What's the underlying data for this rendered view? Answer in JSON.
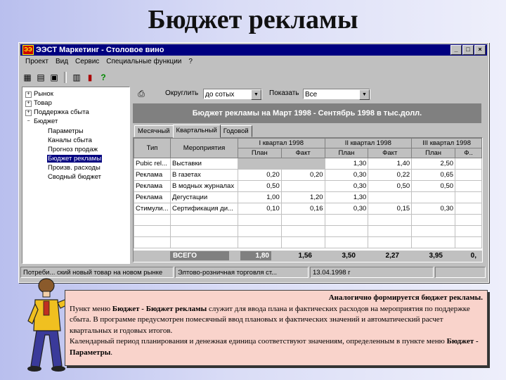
{
  "slide": {
    "title": "Бюджет рекламы"
  },
  "window": {
    "title": "ЭЭСТ Маркетинг - Столовое вино",
    "app_icon": "ЭЭ",
    "controls": {
      "minimize": "_",
      "maximize": "□",
      "close": "×"
    }
  },
  "menu": [
    "Проект",
    "Вид",
    "Сервис",
    "Специальные функции",
    "?"
  ],
  "toolbar_icons": [
    "grid-icon",
    "table-icon",
    "form-icon",
    "calculator-icon",
    "exit-door-icon",
    "help-icon"
  ],
  "tree": [
    {
      "label": "Рынок",
      "expander": "+",
      "level": 0
    },
    {
      "label": "Товар",
      "expander": "+",
      "level": 0
    },
    {
      "label": "Поддержка сбыта",
      "expander": "+",
      "level": 0
    },
    {
      "label": "Бюджет",
      "expander": "−",
      "level": 0
    },
    {
      "label": "Параметры",
      "level": 1
    },
    {
      "label": "Каналы сбыта",
      "level": 1
    },
    {
      "label": "Прогноз продаж",
      "level": 1
    },
    {
      "label": "Бюджет рекламы",
      "level": 1,
      "selected": true
    },
    {
      "label": "Произв. расходы",
      "level": 1
    },
    {
      "label": "Сводный бюджет",
      "level": 1
    }
  ],
  "options": {
    "round_label": "Округлить",
    "round_value": "до сотых",
    "show_label": "Показать",
    "show_value": "Все"
  },
  "banner": "Бюджет рекламы на Март 1998 - Сентябрь 1998 в тыс.долл.",
  "tabs": [
    "Месячный",
    "Квартальный",
    "Годовой"
  ],
  "grid": {
    "col_type": "Тип",
    "col_event": "Мероприятия",
    "quarters": [
      "I квартал 1998",
      "II квартал 1998",
      "III квартал 1998"
    ],
    "plan": "План",
    "fact": "Факт",
    "fact_cut": "Ф..",
    "rows": [
      {
        "type": "Pubic rel...",
        "event": "Выставки",
        "v": [
          "",
          "",
          "1,30",
          "1,40",
          "2,50",
          ""
        ]
      },
      {
        "type": "Реклама",
        "event": "В газетах",
        "v": [
          "0,20",
          "0,20",
          "0,30",
          "0,22",
          "0,65",
          ""
        ]
      },
      {
        "type": "Реклама",
        "event": "В модных журналах",
        "v": [
          "0,50",
          "",
          "0,30",
          "0,50",
          "0,50",
          ""
        ]
      },
      {
        "type": "Реклама",
        "event": "Дегустации",
        "v": [
          "1,00",
          "1,20",
          "1,30",
          "",
          "",
          ""
        ]
      },
      {
        "type": "Стимули...",
        "event": "Сертификация ди...",
        "v": [
          "0,10",
          "0,16",
          "0,30",
          "0,15",
          "0,30",
          ""
        ]
      }
    ],
    "total_label": "ВСЕГО",
    "totals": [
      "1,80",
      "1,56",
      "3,50",
      "2,27",
      "3,95",
      "0,"
    ]
  },
  "status": [
    "Потреби... ский новый товар на новом рынке",
    "Элтово-розничная торговля ст...",
    "13.04.1998 г"
  ],
  "note": {
    "line1": "Аналогично формируется бюджет рекламы.",
    "p1_a": "Пункт меню ",
    "p1_b": "Бюджет - Бюджет рекламы",
    "p1_c": " служит для ввода плана и фактических расходов на мероприятия по поддержке сбыта. В программе предусмотрен помесячный ввод плановых и фактических значений и автоматический расчет квартальных и годовых итогов.",
    "p2_a": "Календарный период планирования и денежная единица соответствуют значениям, определенным в пункте меню ",
    "p2_b": "Бюджет - Параметры",
    "p2_c": "."
  },
  "colors": {
    "titlebar": "#000080",
    "face": "#c0c0c0",
    "note_bg": "#f9d3cb",
    "figure_jacket": "#f0c020"
  }
}
